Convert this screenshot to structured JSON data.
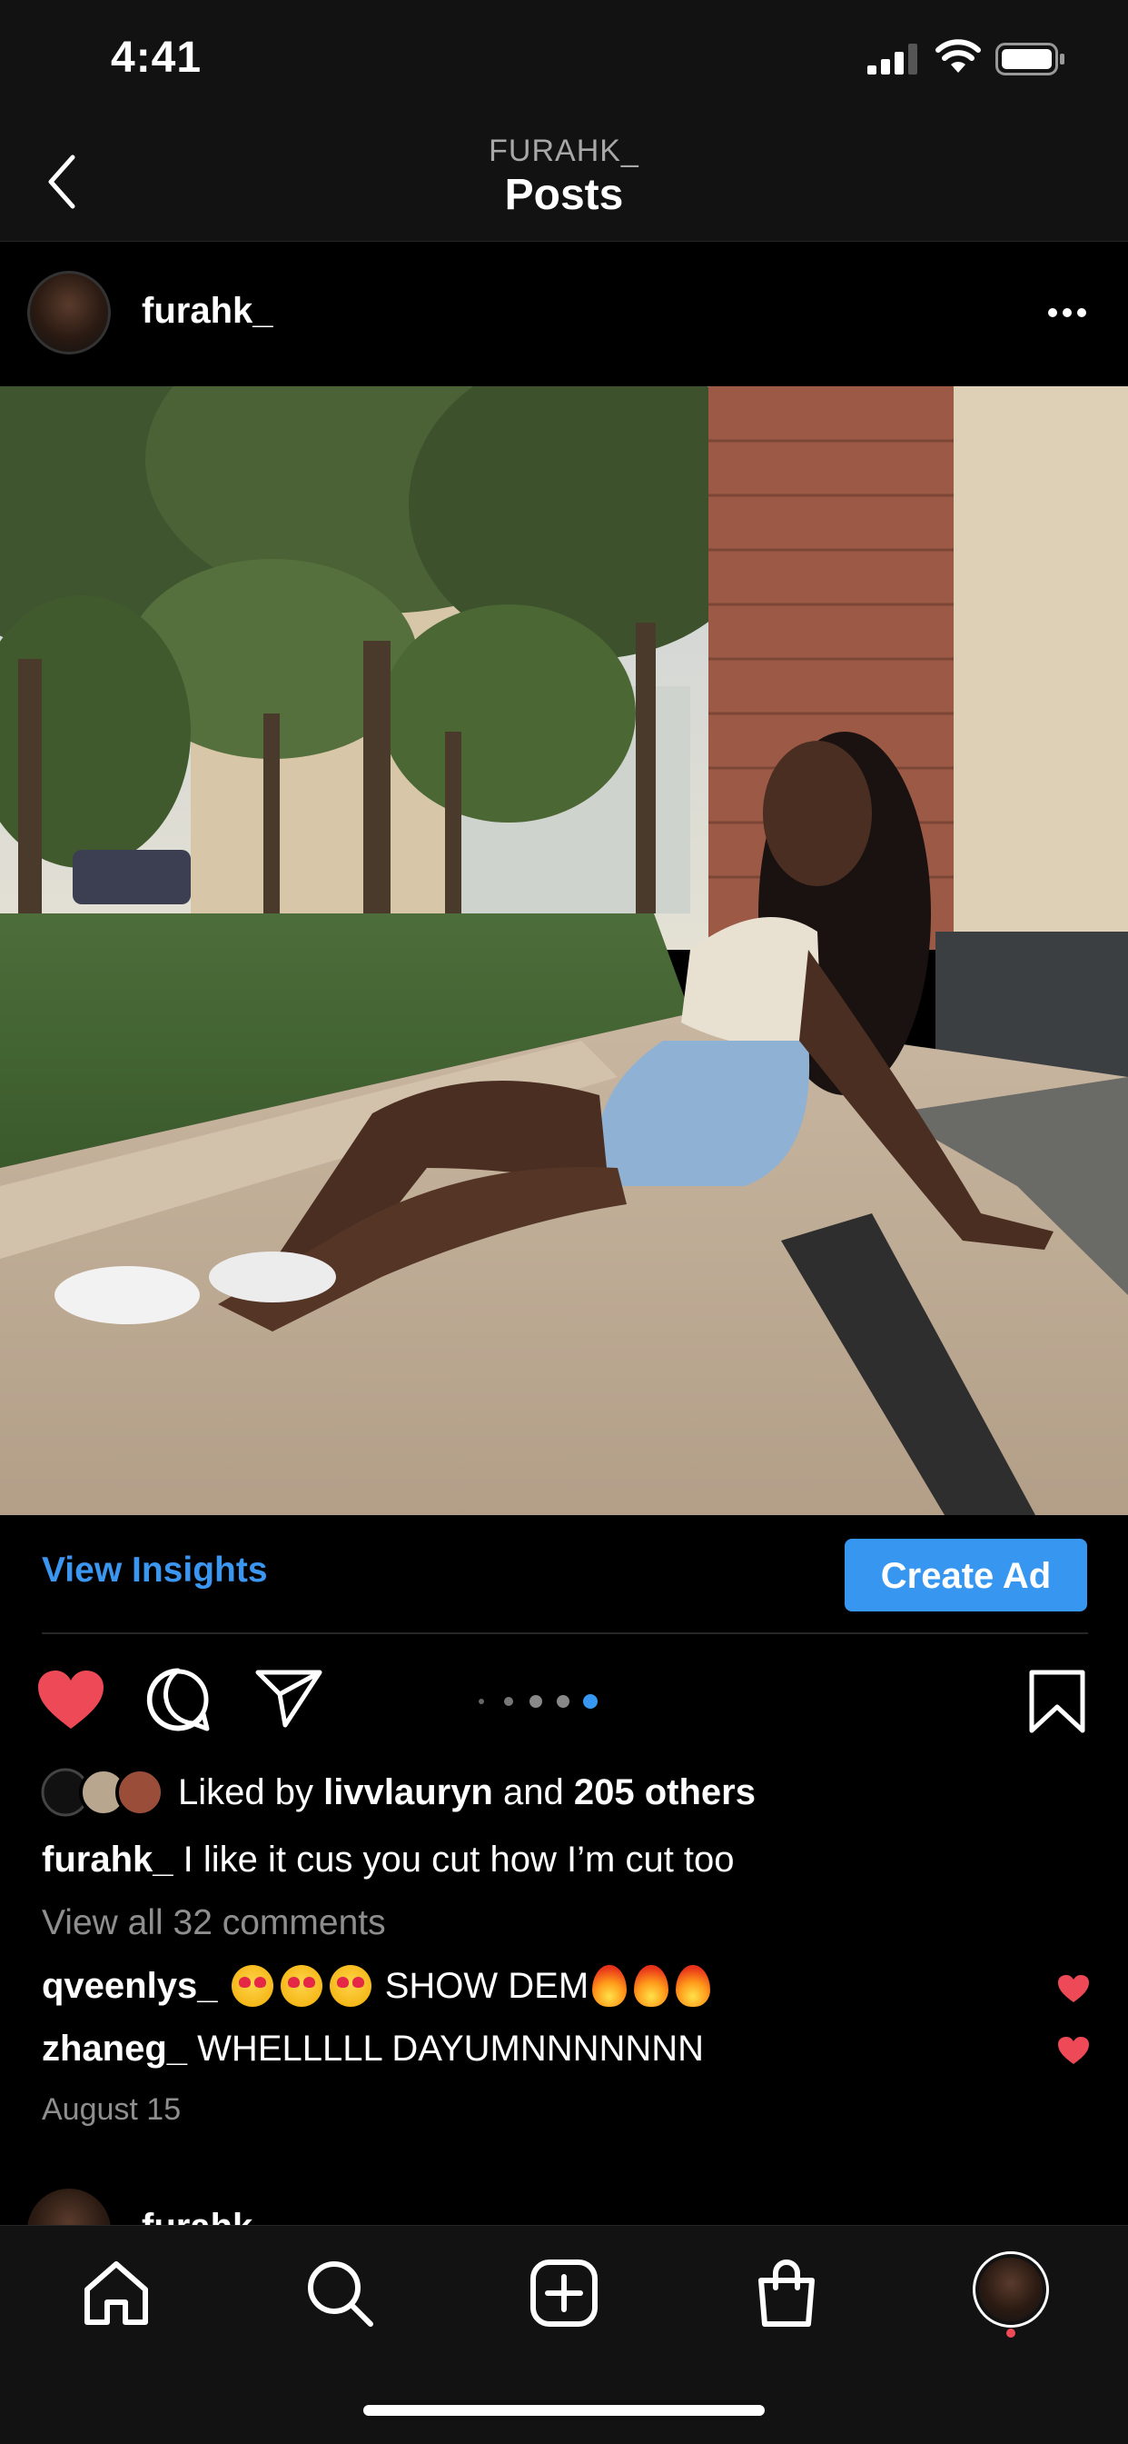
{
  "status": {
    "time": "4:41"
  },
  "nav": {
    "subtitle": "FURAHK_",
    "title": "Posts"
  },
  "post": {
    "username": "furahk_",
    "insights_label": "View Insights",
    "create_ad_label": "Create Ad",
    "carousel": {
      "count": 5,
      "active": 4
    },
    "likes": {
      "prefix": "Liked by",
      "user": "livvlauryn",
      "middle": "and",
      "others": "205 others"
    },
    "caption": {
      "user": "furahk_",
      "text": "I like it cus you cut how I’m cut too"
    },
    "view_all": "View all 32 comments",
    "comments": [
      {
        "user": "qveenlys_",
        "text": "SHOW DEM"
      },
      {
        "user": "zhaneg_",
        "text": "WHELLLLL DAYUMNNNNNNN"
      }
    ],
    "date": "August 15"
  },
  "next_post": {
    "username": "furahk_"
  },
  "colors": {
    "accent": "#3797f0",
    "like": "#ed4956"
  },
  "tabs": [
    "home-icon",
    "search-icon",
    "new-post-icon",
    "shop-icon",
    "profile"
  ]
}
